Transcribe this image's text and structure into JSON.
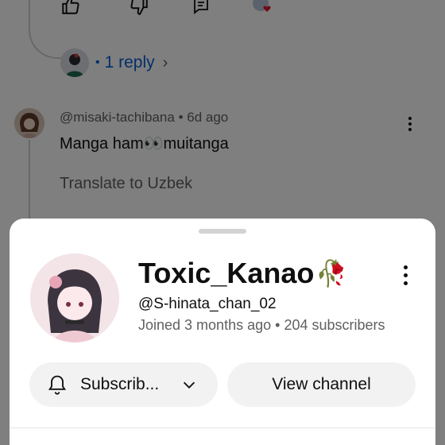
{
  "background": {
    "reply": {
      "count_label": "1 reply",
      "separator": "•"
    },
    "comment": {
      "author": "@misaki-tachibana",
      "age": "6d ago",
      "separator": "•",
      "text": "Manga ham👀muitanga",
      "translate_label": "Translate to Uzbek"
    }
  },
  "sheet": {
    "channel_name": "Toxic_Kanao",
    "channel_emoji": "🥀",
    "handle": "@S-hinata_chan_02",
    "joined": "Joined 3 months ago",
    "stats_separator": "•",
    "subscribers": "204 subscribers",
    "subscribe_label": "Subscrib...",
    "view_channel_label": "View channel"
  },
  "colors": {
    "link_blue": "#065fd4",
    "secondary_text": "#606060",
    "button_bg": "#f2f2f2",
    "scrim": "rgba(0,0,0,0.5)"
  },
  "icons": [
    "thumbs-up-icon",
    "thumbs-down-icon",
    "reply-icon",
    "creator-heart-icon",
    "chevron-right-icon",
    "more-vert-icon",
    "bell-icon",
    "chevron-down-icon"
  ]
}
